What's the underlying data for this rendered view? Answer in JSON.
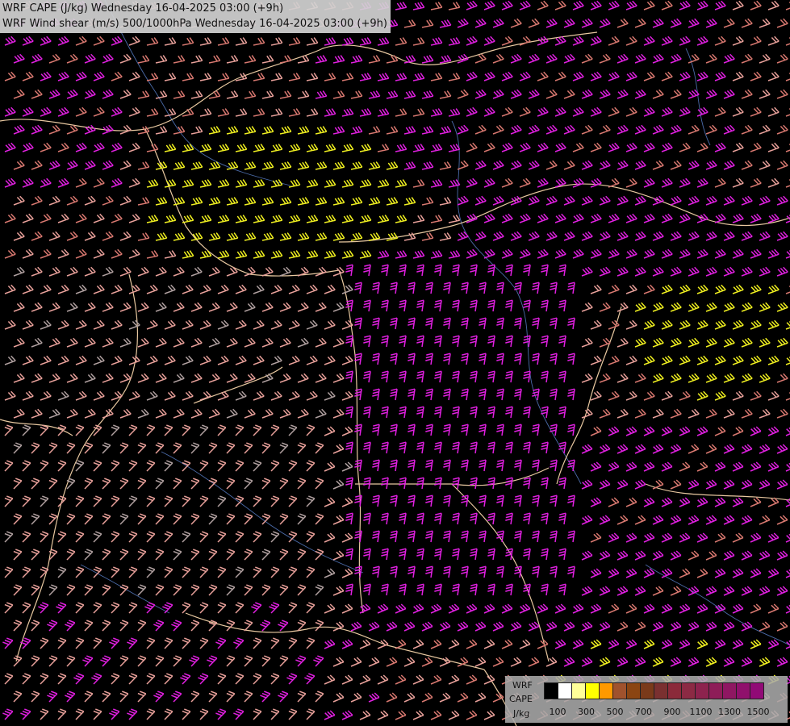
{
  "title": {
    "line1": "WRF CAPE (J/kg) Wednesday 16-04-2025 03:00 (+9h)",
    "line2": "WRF Wind shear (m/s) 500/1000hPa Wednesday 16-04-2025 03:00 (+9h)"
  },
  "legend": {
    "model": "WRF",
    "variable": "CAPE",
    "unit": "J/kg",
    "tick_labels": [
      "100",
      "300",
      "500",
      "700",
      "900",
      "1100",
      "1300",
      "1500"
    ],
    "swatch_colors": [
      "#000000",
      "#ffffff",
      "#ffff99",
      "#ffff00",
      "#ff9900",
      "#a0522d",
      "#8b4513",
      "#7a3a1a",
      "#7a3030",
      "#8b2a3a",
      "#8c2a44",
      "#8d234e",
      "#8e1d58",
      "#8f1762",
      "#90106c",
      "#910a76"
    ]
  },
  "colors": {
    "background": "#000000",
    "barb_pink": "#e8a09a",
    "barb_salmon": "#d87870",
    "barb_magenta": "#e020e0",
    "barb_yellow": "#f0f020",
    "barb_grey": "#b0a0a0",
    "border": "#e8c8a0",
    "river": "#4a6aa8"
  },
  "icons": [
    "wind-barb-icon"
  ]
}
